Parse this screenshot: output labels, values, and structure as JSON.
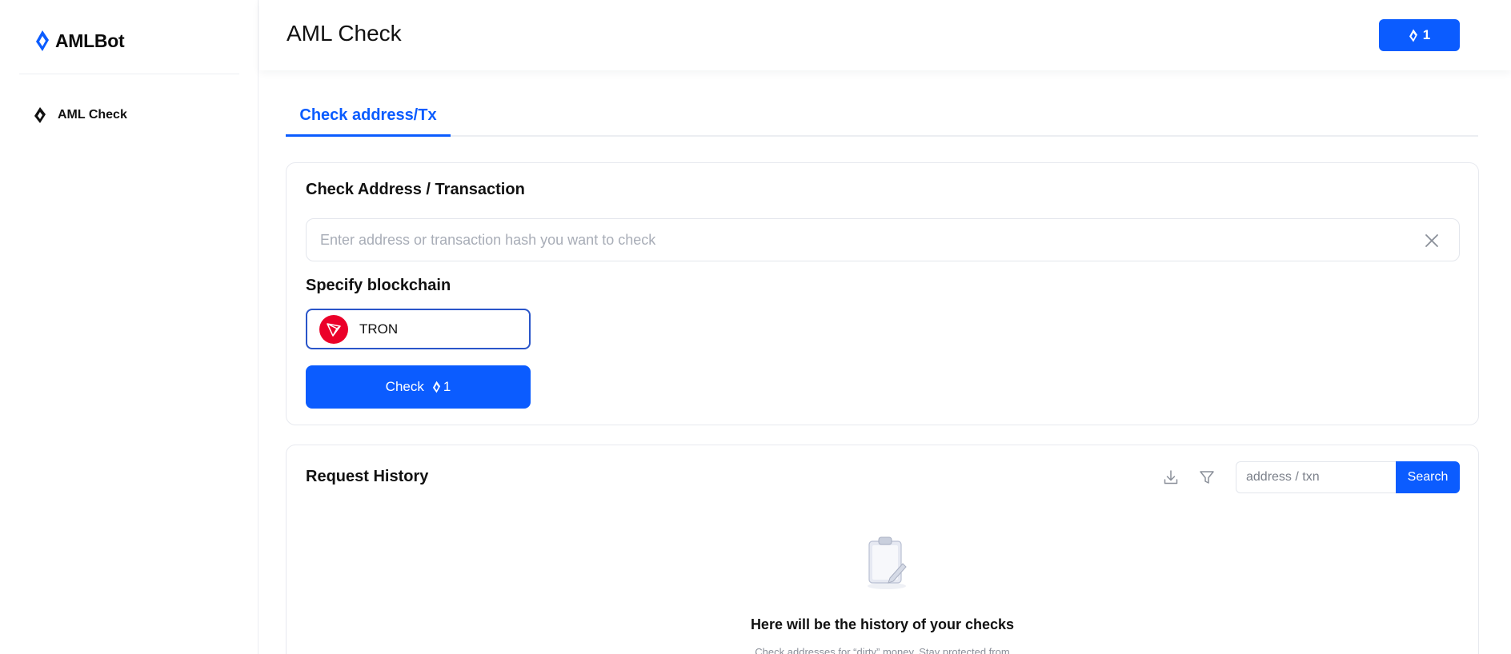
{
  "brand": {
    "name": "AMLBot",
    "accent": "#0b5cff"
  },
  "sidebar": {
    "items": [
      {
        "label": "AML Check",
        "icon": "amlbot-diamond-icon"
      }
    ]
  },
  "header": {
    "title": "AML Check",
    "credits": "1"
  },
  "tabs": [
    {
      "label": "Check address/Tx",
      "active": true
    }
  ],
  "check_card": {
    "title": "Check Address / Transaction",
    "input_value": "",
    "input_placeholder": "Enter address or transaction hash you want to check",
    "blockchain_label": "Specify blockchain",
    "blockchain_selected": "TRON",
    "check_button_label": "Check",
    "check_cost": "1"
  },
  "history": {
    "title": "Request History",
    "search_placeholder": "address / txn",
    "search_button": "Search",
    "empty_title": "Here will be the history of your checks",
    "empty_subtitle": "Check addresses for “dirty” money. Stay protected from"
  }
}
